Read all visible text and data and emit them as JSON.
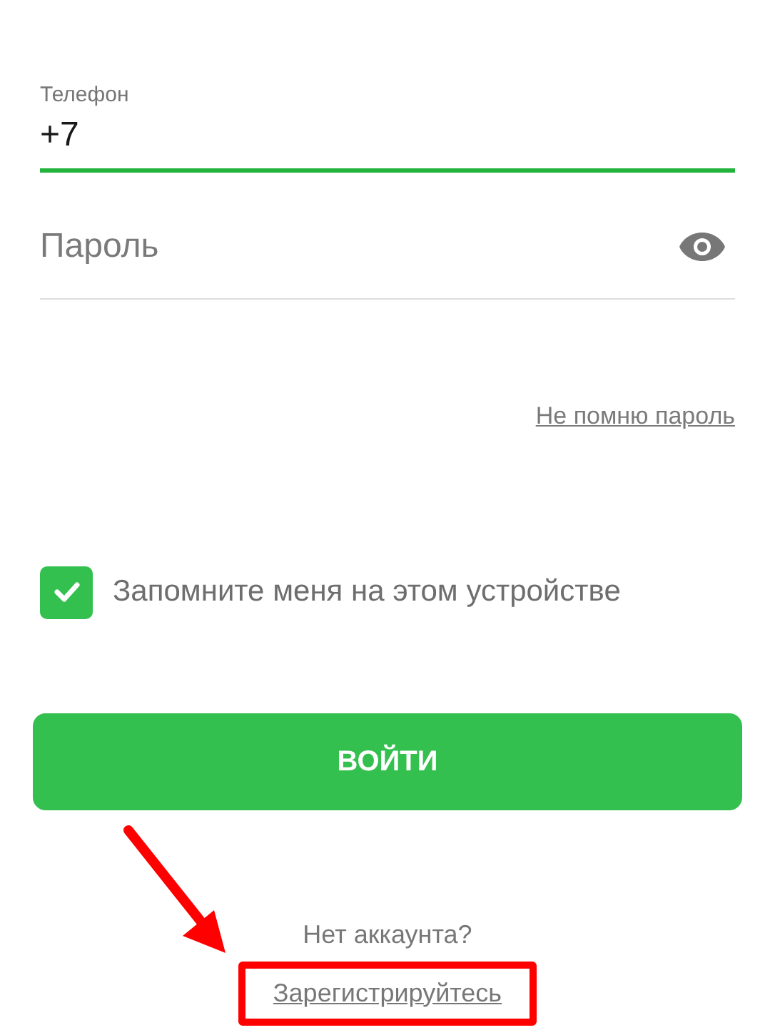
{
  "phone_field": {
    "label": "Телефон",
    "value": "+7",
    "focused": true
  },
  "password_field": {
    "placeholder": "Пароль"
  },
  "forgot_link": "Не помню пароль",
  "remember_checkbox": {
    "label": "Запомните меня на этом устройстве",
    "checked": true
  },
  "login_button": "ВОЙТИ",
  "signup_prompt": "Нет аккаунта?",
  "signup_link": {
    "label": "Зарегистрируйтесь",
    "highlighted": true
  },
  "pointer_arrow": true
}
